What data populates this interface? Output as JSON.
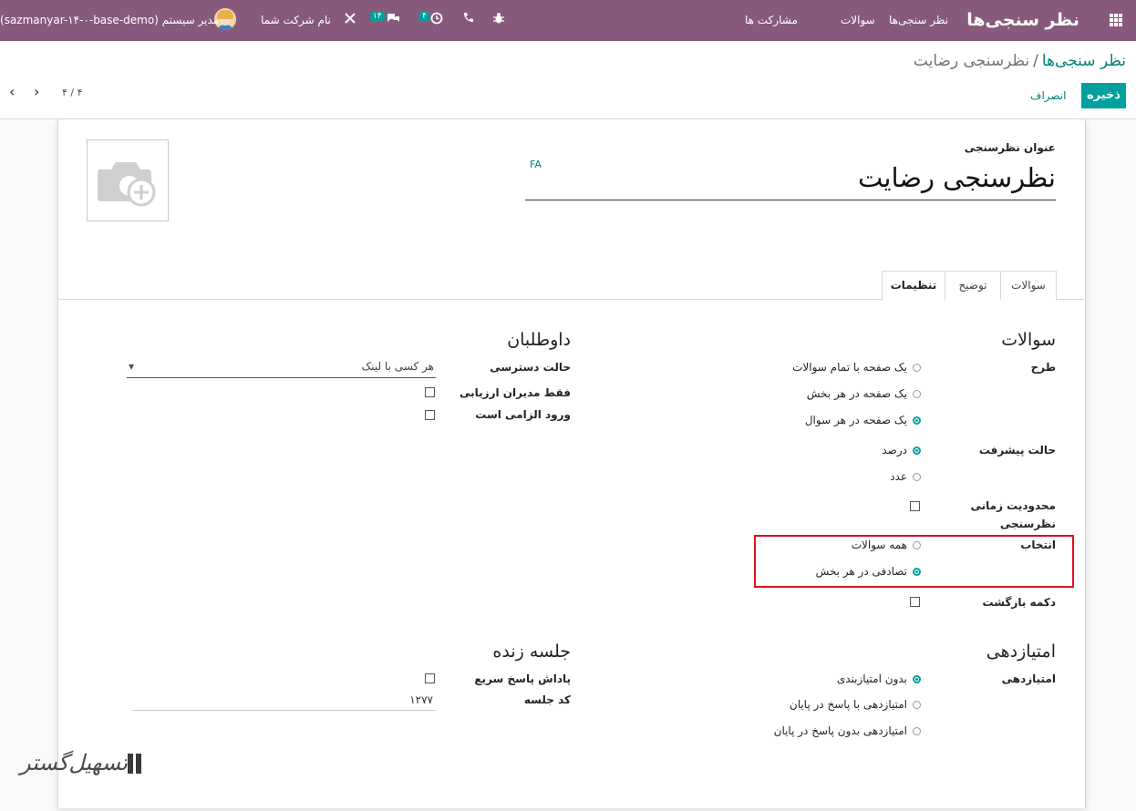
{
  "navbar": {
    "brand": "نظر سنجی‌ها",
    "menu": [
      "نظر سنجی‌ها",
      "سوالات",
      "مشارکت ها"
    ],
    "company": "نام شرکت شما",
    "user": "مدیر سیستم (sazmanyar-۱۴-۰-base-demo)",
    "messages_count": "۱۴",
    "activities_count": "۴",
    "colors": {
      "bar": "#875a7b",
      "badge": "#00a09d"
    },
    "icons": [
      "apps-grid-icon",
      "bug-icon",
      "phone-icon",
      "clock-icon",
      "chat-icon",
      "tools-icon"
    ]
  },
  "control": {
    "breadcrumb_parent": "نظر سنجی‌ها",
    "breadcrumb_separator": "/",
    "breadcrumb_current": "نظرسنجی رضایت",
    "save_label": "ذخیره",
    "discard_label": "انصراف",
    "pager": "۴ / ۴"
  },
  "form": {
    "title_label": "عنوان نظرسنجی",
    "title_value": "نظرسنجی رضایت",
    "lang": "FA",
    "tabs": [
      {
        "label": "سوالات"
      },
      {
        "label": "توضیح"
      },
      {
        "label": "تنظیمات",
        "active": true
      }
    ],
    "questions": {
      "heading": "سوالات",
      "layout_label": "طرح",
      "layout_options": [
        "یک صفحه با تمام سوالات",
        "یک صفحه در هر بخش",
        "یک صفحه در هر سوال"
      ],
      "layout_selected": 2,
      "progress_label": "حالت پیشرفت",
      "progress_options": [
        "درصد",
        "عدد"
      ],
      "progress_selected": 0,
      "time_limit_label_1": "محدودیت زمانی",
      "time_limit_label_2": "نظرسنجی",
      "selection_label": "انتخاب",
      "selection_options": [
        "همه سوالات",
        "تصادفی در هر بخش"
      ],
      "selection_selected": 1,
      "back_button_label": "دکمه بازگشت"
    },
    "candidates": {
      "heading": "داوطلبان",
      "access_label": "حالت دسترسی",
      "access_value": "هر کسی با لینک",
      "managers_only_label": "فقط مدیران ارزیابی",
      "login_required_label": "ورود الزامی است"
    },
    "scoring": {
      "heading": "امتیازدهی",
      "label": "امتیازدهی",
      "options": [
        "بدون امتیازبندی",
        "امتیازدهی با پاسخ در پایان",
        "امتیازدهی بدون پاسخ در پایان"
      ],
      "selected": 0
    },
    "live_session": {
      "heading": "جلسه زنده",
      "reward_label": "پاداش پاسخ سریع",
      "code_label": "کد جلسه",
      "code_value": "۱۲۷۷"
    }
  },
  "watermark": {
    "text": "تسهیل‌گستر"
  }
}
